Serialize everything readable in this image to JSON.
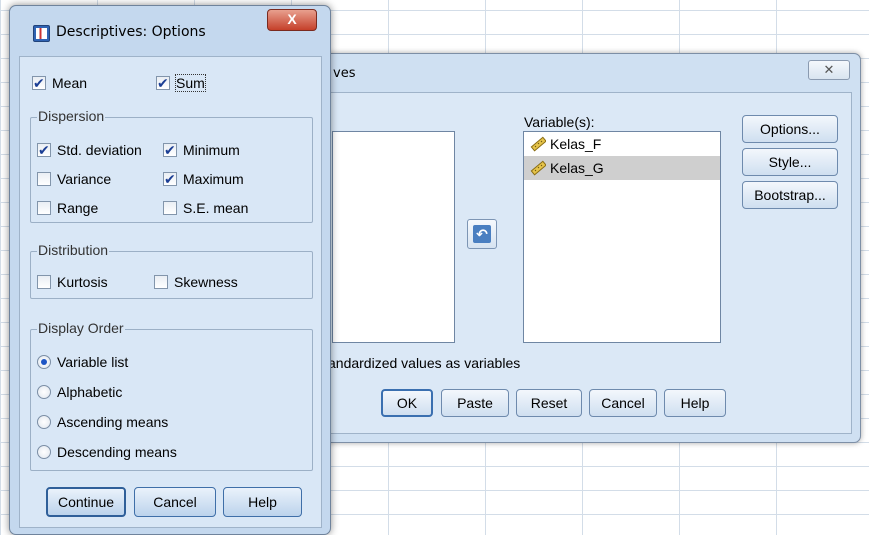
{
  "descriptives_dialog": {
    "title": "ves",
    "close_symbol": "✕",
    "variables_label": "Variable(s):",
    "variables": [
      "Kelas_F",
      "Kelas_G"
    ],
    "move_arrow": "↶",
    "side_buttons": {
      "options": "Options...",
      "style": "Style...",
      "bootstrap": "Bootstrap..."
    },
    "save_text": "andardized values as variables",
    "buttons": {
      "ok": "OK",
      "paste": "Paste",
      "reset": "Reset",
      "cancel": "Cancel",
      "help": "Help"
    }
  },
  "options_dialog": {
    "title": "Descriptives: Options",
    "close_symbol": "X",
    "mean": {
      "label": "Mean",
      "checked": true
    },
    "sum": {
      "label": "Sum",
      "checked": true
    },
    "dispersion": {
      "legend": "Dispersion",
      "std_deviation": {
        "label": "Std. deviation",
        "checked": true
      },
      "minimum": {
        "label": "Minimum",
        "checked": true
      },
      "variance": {
        "label": "Variance",
        "checked": false
      },
      "maximum": {
        "label": "Maximum",
        "checked": true
      },
      "range": {
        "label": "Range",
        "checked": false
      },
      "se_mean": {
        "label": "S.E. mean",
        "checked": false
      }
    },
    "distribution": {
      "legend": "Distribution",
      "kurtosis": {
        "label": "Kurtosis",
        "checked": false
      },
      "skewness": {
        "label": "Skewness",
        "checked": false
      }
    },
    "display_order": {
      "legend": "Display Order",
      "options": [
        "Variable list",
        "Alphabetic",
        "Ascending means",
        "Descending means"
      ],
      "selected": "Variable list"
    },
    "buttons": {
      "continue": "Continue",
      "cancel": "Cancel",
      "help": "Help"
    }
  },
  "colors": {
    "dialog_bg": "#d9e7f6",
    "check_color": "#1c3f95",
    "close_red": "#c5402a"
  }
}
